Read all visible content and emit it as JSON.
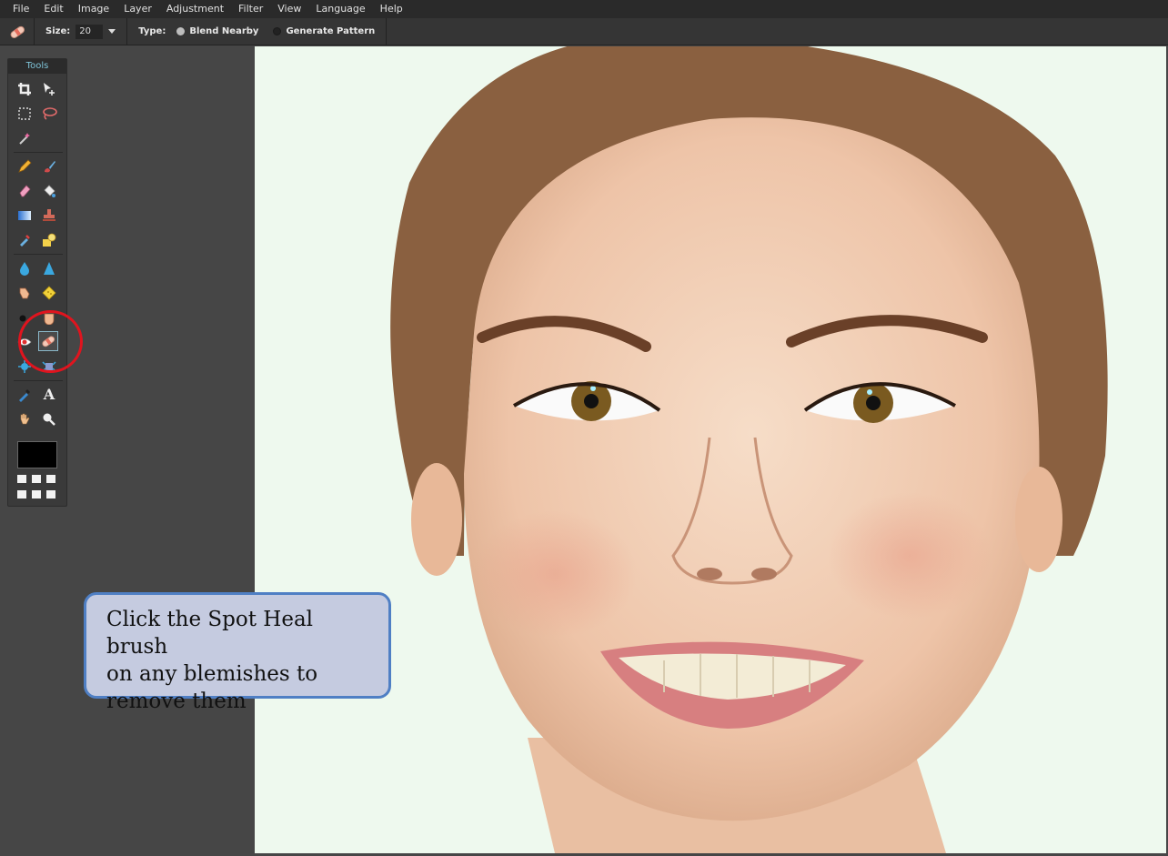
{
  "menu": {
    "items": [
      "File",
      "Edit",
      "Image",
      "Layer",
      "Adjustment",
      "Filter",
      "View",
      "Language",
      "Help"
    ]
  },
  "options": {
    "size_label": "Size:",
    "size_value": "20",
    "type_label": "Type:",
    "radio_blend": "Blend Nearby",
    "radio_pattern": "Generate Pattern",
    "selected_type": "Blend Nearby"
  },
  "tools": {
    "title": "Tools",
    "selected": "spot-heal",
    "foreground_color": "#000000"
  },
  "callout": {
    "line1": "Click the Spot Heal brush",
    "line2": "on any blemishes to",
    "line3": "remove them"
  },
  "colors": {
    "accent_title": "#7ec3d8",
    "annotation_ring": "#e0141e",
    "callout_fill": "#c5cbe0",
    "callout_border": "#4f7fc4"
  }
}
